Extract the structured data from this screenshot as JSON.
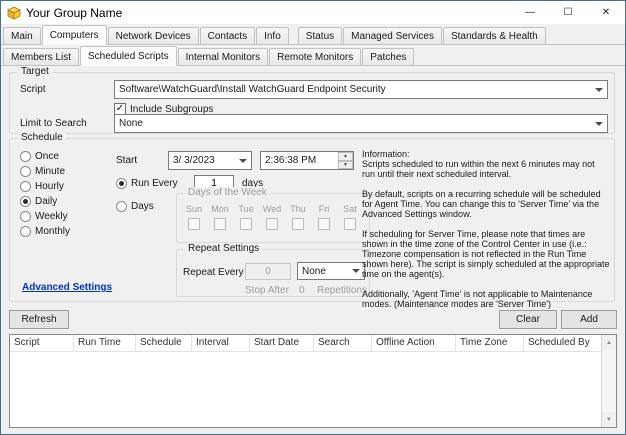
{
  "window": {
    "title": "Your Group Name",
    "minimize_glyph": "—",
    "maximize_glyph": "☐",
    "close_glyph": "✕"
  },
  "main_tabs": [
    {
      "label": "Main"
    },
    {
      "label": "Computers"
    },
    {
      "label": "Network Devices"
    },
    {
      "label": "Contacts"
    },
    {
      "label": "Info"
    },
    {
      "label": "Status"
    },
    {
      "label": "Managed Services"
    },
    {
      "label": "Standards & Health"
    }
  ],
  "sub_tabs": [
    {
      "label": "Members List"
    },
    {
      "label": "Scheduled Scripts"
    },
    {
      "label": "Internal Monitors"
    },
    {
      "label": "Remote Monitors"
    },
    {
      "label": "Patches"
    }
  ],
  "target": {
    "group_label": "Target",
    "script_label": "Script",
    "script_value": "Software\\WatchGuard\\Install WatchGuard Endpoint Security",
    "include_subgroups_label": "Include Subgroups",
    "include_subgroups_checked": true,
    "limit_label": "Limit to Search",
    "limit_value": "None"
  },
  "schedule": {
    "group_label": "Schedule",
    "frequency_options": [
      "Once",
      "Minute",
      "Hourly",
      "Daily",
      "Weekly",
      "Monthly"
    ],
    "frequency_selected": "Daily",
    "start_label": "Start",
    "start_date": "3/ 3/2023",
    "start_time": "2:36:38 PM",
    "run_every_label": "Run Every",
    "run_every_value": "1",
    "run_every_unit": "days",
    "days_label": "Days",
    "days_of_week": {
      "group_label": "Days of the Week",
      "days": [
        "Sun",
        "Mon",
        "Tue",
        "Wed",
        "Thu",
        "Fri",
        "Sat"
      ]
    },
    "repeat_settings": {
      "group_label": "Repeat Settings",
      "repeat_every_label": "Repeat Every",
      "repeat_every_value": "0",
      "repeat_unit_value": "None",
      "stop_after_label": "Stop After",
      "stop_after_value": "0",
      "repetitions_label": "Repetitions"
    },
    "information_text": "Information:\nScripts scheduled to run within the next 6 minutes may not run until their next scheduled interval.\n\nBy default, scripts on a recurring schedule will be scheduled for Agent Time. You can change this to 'Server Time' via the Advanced Settings window.\n\nIf scheduling for Server Time, please note that times are shown in the time zone of the Control Center in use (i.e.: Timezone compensation is not reflected in the Run Time shown here). The script is simply scheduled at the appropriate time on the agent(s).\n\nAdditionally, 'Agent Time' is not applicable to Maintenance modes. (Maintenance modes are 'Server Time')",
    "advanced_settings_label": "Advanced Settings"
  },
  "actions": {
    "refresh_label": "Refresh",
    "clear_label": "Clear",
    "add_label": "Add"
  },
  "scripts_table": {
    "columns": [
      "Script",
      "Run Time",
      "Schedule",
      "Interval",
      "Start Date",
      "Search",
      "Offline Action",
      "Time Zone",
      "Scheduled By"
    ],
    "rows": []
  }
}
